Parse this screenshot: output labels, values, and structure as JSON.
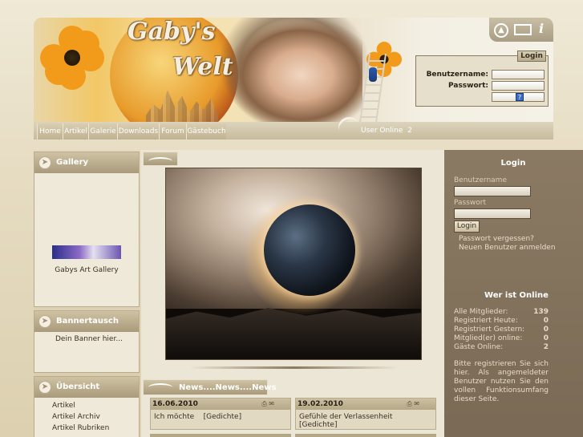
{
  "header": {
    "title_line1": "Gaby's",
    "title_line2": "Welt",
    "login_button": "Login",
    "username_label": "Benutzername:",
    "password_label": "Passwort:",
    "help_icon": "?",
    "icons": [
      "up-arrow-icon",
      "mail-icon",
      "info-icon"
    ]
  },
  "nav": {
    "items": [
      "Home",
      "Artikel",
      "Galerie",
      "Downloads",
      "Forum",
      "Gästebuch"
    ],
    "user_online_label": "User Online",
    "user_online_count": "2"
  },
  "left": {
    "gallery_title": "Gallery",
    "gallery_caption": "Gabys Art Gallery",
    "banner_title": "Bannertausch",
    "banner_text": "Dein Banner hier...",
    "overview_title": "Übersicht",
    "overview_links": [
      "Artikel",
      "Artikel Archiv",
      "Artikel Rubriken"
    ]
  },
  "news": {
    "heading": "News....News....News",
    "items": [
      {
        "date": "16.06.2010",
        "title": "Ich möchte",
        "category": "[Gedichte]"
      },
      {
        "date": "19.02.2010",
        "title": "Gefühle der Verlassenheit",
        "category": "[Gedichte]"
      }
    ]
  },
  "right": {
    "login_title": "Login",
    "username_label": "Benutzername",
    "password_label": "Passwort",
    "login_button": "Login",
    "forgot_password": "Passwort vergessen?",
    "register": "Neuen Benutzer anmelden",
    "online_title": "Wer ist Online",
    "stats": [
      {
        "label": "Alle Mitglieder:",
        "value": "139"
      },
      {
        "label": "Registriert Heute:",
        "value": "0"
      },
      {
        "label": "Registriert Gestern:",
        "value": "0"
      },
      {
        "label": "Mitglied(er) online:",
        "value": "0"
      },
      {
        "label": "Gäste Online:",
        "value": "2"
      }
    ],
    "note": "Bitte registrieren Sie sich hier. Als angemeldeter Benutzer nutzen Sie den vollen Funktionsumfang dieser Seite."
  },
  "colors": {
    "accent": "#a89a7a",
    "right_column": "#8b7a63"
  }
}
